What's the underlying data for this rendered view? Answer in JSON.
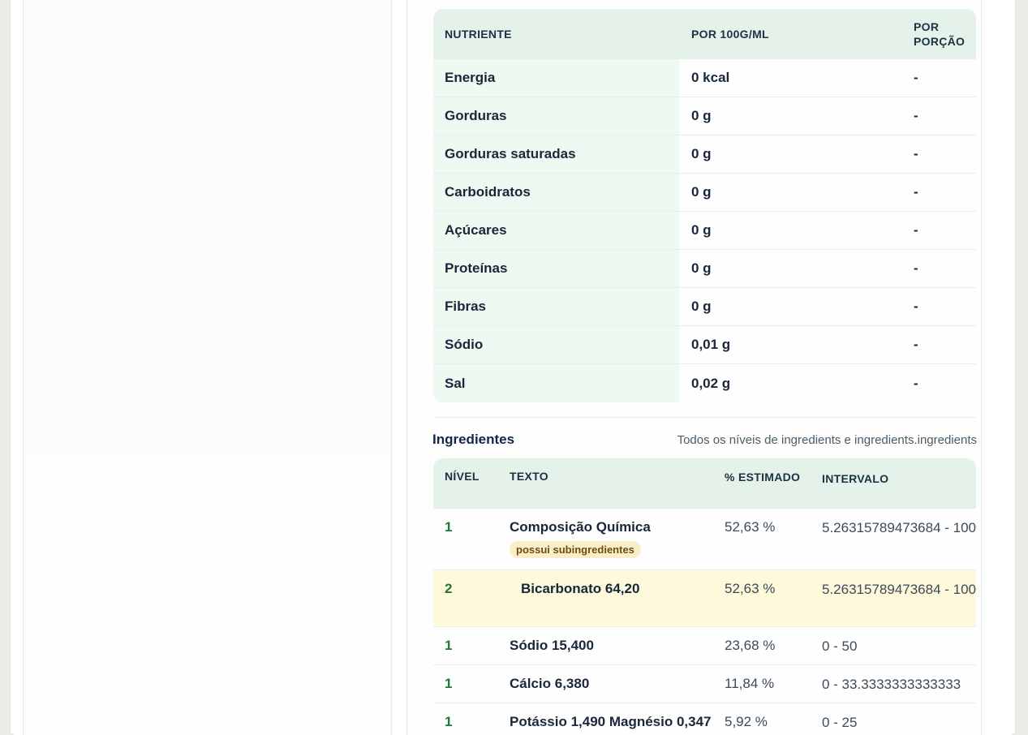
{
  "nutrition": {
    "headers": {
      "nutrient": "NUTRIENTE",
      "per100": "POR 100G/ML",
      "perPortion": "POR PORÇÃO"
    },
    "rows": [
      {
        "name": "Energia",
        "per100": "0 kcal",
        "portion": "-"
      },
      {
        "name": "Gorduras",
        "per100": "0 g",
        "portion": "-"
      },
      {
        "name": "Gorduras saturadas",
        "per100": "0 g",
        "portion": "-"
      },
      {
        "name": "Carboidratos",
        "per100": "0 g",
        "portion": "-"
      },
      {
        "name": "Açúcares",
        "per100": "0 g",
        "portion": "-"
      },
      {
        "name": "Proteínas",
        "per100": "0 g",
        "portion": "-"
      },
      {
        "name": "Fibras",
        "per100": "0 g",
        "portion": "-"
      },
      {
        "name": "Sódio",
        "per100": "0,01 g",
        "portion": "-"
      },
      {
        "name": "Sal",
        "per100": "0,02 g",
        "portion": "-"
      }
    ]
  },
  "ingredients": {
    "title": "Ingredientes",
    "note": "Todos os níveis de ingredients e ingredients.ingredients",
    "headers": {
      "level": "NÍVEL",
      "text": "TEXTO",
      "estimated": "% ESTIMADO",
      "interval": "INTERVALO"
    },
    "rows": [
      {
        "level": "1",
        "text": "Composição Química",
        "badge": "possui subingredientes",
        "estimated": "52,63 %",
        "interval": "5.26315789473684 - 100"
      },
      {
        "level": "2",
        "text": "Bicarbonato 64,20",
        "estimated": "52,63 %",
        "interval": "5.26315789473684 - 100"
      },
      {
        "level": "1",
        "text": "Sódio 15,400",
        "estimated": "23,68 %",
        "interval": "0 - 50"
      },
      {
        "level": "1",
        "text": "Cálcio 6,380",
        "estimated": "11,84 %",
        "interval": "0 - 33.3333333333333"
      },
      {
        "level": "1",
        "text": "Potássio 1,490 Magnésio 0,347",
        "estimated": "5,92 %",
        "interval": "0 - 25"
      }
    ]
  },
  "colors": {
    "headerBg": "#e5f2ea",
    "rowLabelBg": "#f0f8f2",
    "highlightRow": "#fdf9da",
    "levelGreen": "#1f7a35",
    "badgeBg": "#fbefc9"
  }
}
